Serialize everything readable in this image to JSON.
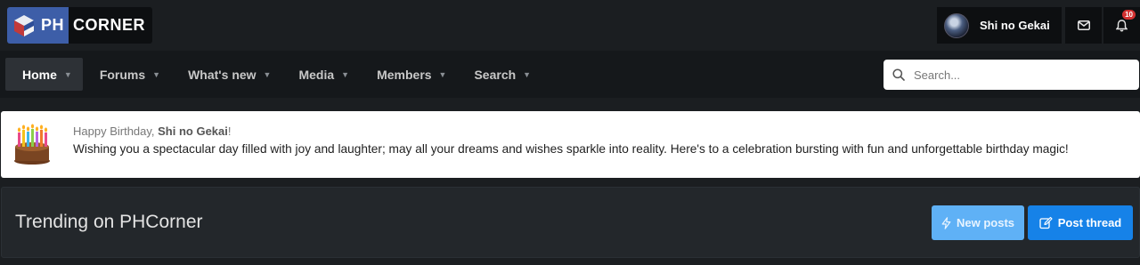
{
  "brand": {
    "logo_part1": "PH",
    "logo_part2": "CORNER",
    "accent": "#3d5ea8"
  },
  "user": {
    "name": "Shi no Gekai",
    "inbox_icon": "envelope-icon",
    "alerts_icon": "bell-icon",
    "alerts_count": "10"
  },
  "nav": {
    "tabs": [
      {
        "label": "Home",
        "active": true
      },
      {
        "label": "Forums"
      },
      {
        "label": "What's new"
      },
      {
        "label": "Media"
      },
      {
        "label": "Members"
      },
      {
        "label": "Search"
      }
    ],
    "search_placeholder": "Search..."
  },
  "birthday": {
    "greeting": "Happy Birthday, ",
    "name": "Shi no Gekai",
    "greeting_end": "!",
    "message": "Wishing you a spectacular day filled with joy and laughter; may all your dreams and wishes sparkle into reality. Here's to a celebration bursting with fun and unforgettable birthday magic!"
  },
  "trending": {
    "title": "Trending on PHCorner",
    "new_posts_label": "New posts",
    "post_thread_label": "Post thread"
  }
}
